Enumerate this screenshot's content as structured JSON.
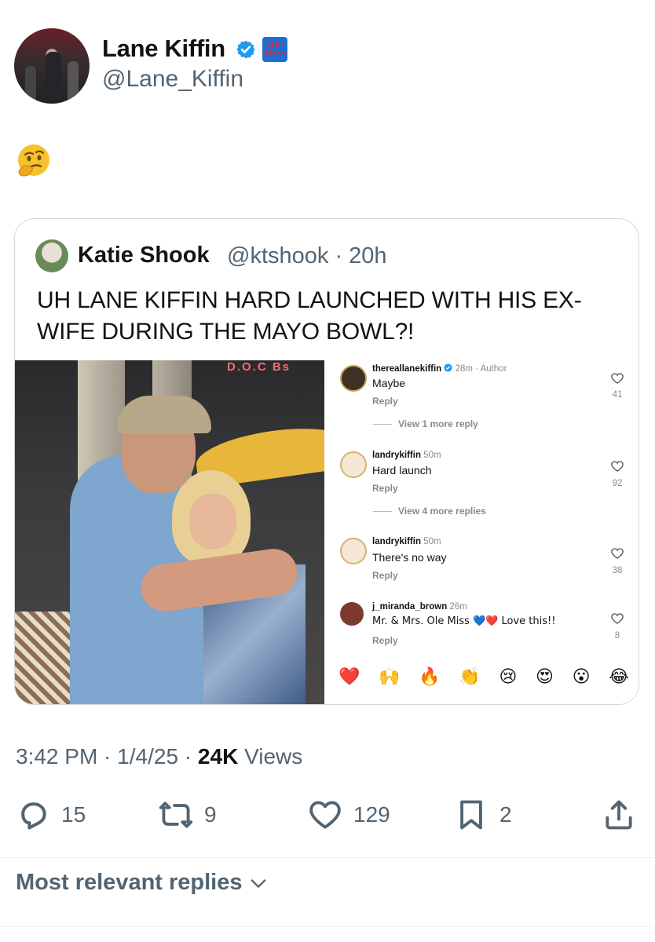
{
  "author": {
    "name": "Lane Kiffin",
    "handle": "@Lane_Kiffin",
    "affiliation_badge": "Ole Miss"
  },
  "post": {
    "emoji": "🤔"
  },
  "quoted": {
    "name": "Katie Shook",
    "handle": "@ktshook",
    "time": "20h",
    "text": "UH LANE KIFFIN HARD LAUNCHED WITH HIS EX-WIFE DURING THE MAYO BOWL?!",
    "photo_sign": "D.O.C Bs",
    "comments": [
      {
        "user": "thereallanekiffin",
        "verified": true,
        "time": "28m · Author",
        "text": "Maybe",
        "reply": "Reply",
        "likes": "41"
      },
      {
        "more": "View 1 more reply"
      },
      {
        "user": "landrykiffin",
        "time": "50m",
        "text": "Hard launch",
        "reply": "Reply",
        "likes": "92"
      },
      {
        "more": "View 4 more replies"
      },
      {
        "user": "landrykiffin",
        "time": "50m",
        "text": "There's no way",
        "reply": "Reply",
        "likes": "38"
      },
      {
        "user": "j_miranda_brown",
        "time": "26m",
        "text": "Mr. & Mrs. Ole Miss 💙❤️ Love this!!",
        "reply": "Reply",
        "likes": "8"
      }
    ],
    "reactions": [
      "❤️",
      "🙌",
      "🔥",
      "👏",
      "😢",
      "😍",
      "😮",
      "😂"
    ]
  },
  "meta": {
    "time": "3:42 PM",
    "date": "1/4/25",
    "views_count": "24K",
    "views_label": "Views"
  },
  "actions": {
    "replies": "15",
    "reposts": "9",
    "likes": "129",
    "bookmarks": "2"
  },
  "replies_sort": "Most relevant replies",
  "colors": {
    "verified": "#1d9bf0",
    "secondary_text": "#536471",
    "border": "#cfd9de"
  }
}
